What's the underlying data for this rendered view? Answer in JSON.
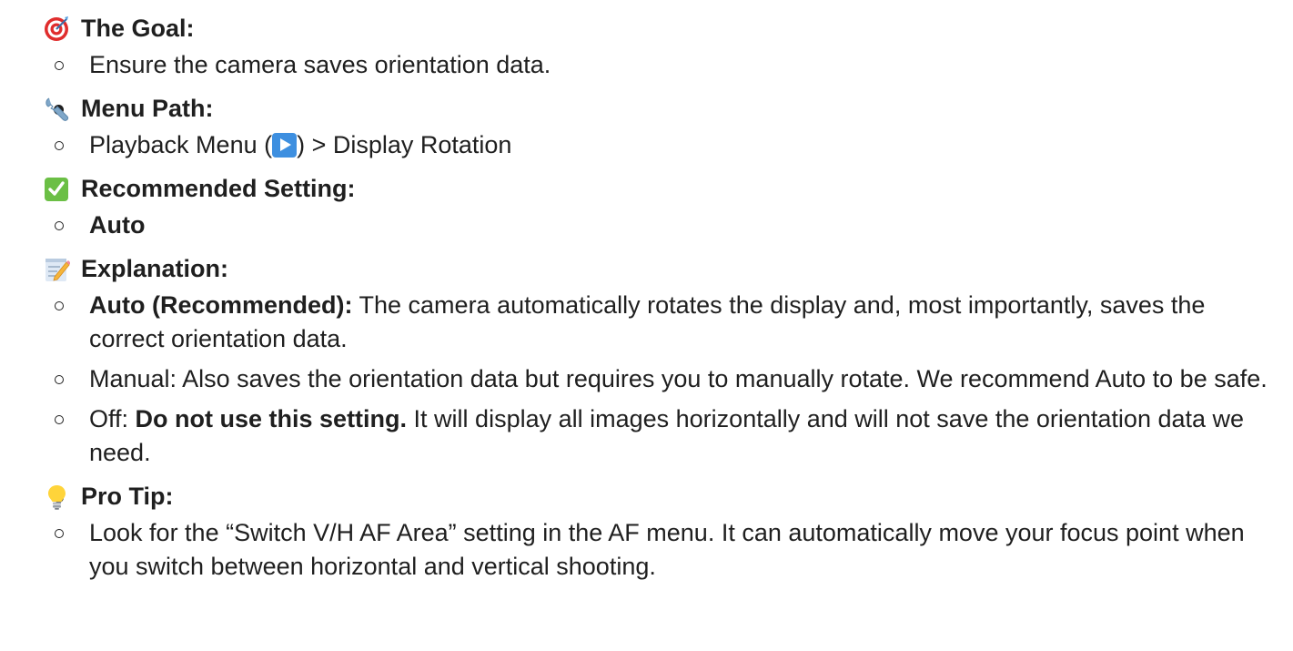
{
  "sections": [
    {
      "icon": "direct-hit-target-icon",
      "heading": "The Goal:",
      "items": [
        {
          "text": "Ensure the camera saves orientation data."
        }
      ]
    },
    {
      "icon": "wrench-icon",
      "heading": "Menu Path:",
      "items": [
        {
          "before": "Playback Menu (",
          "icon": "play-button-icon",
          "after": ") > Display Rotation"
        }
      ]
    },
    {
      "icon": "check-mark-button-icon",
      "heading": "Recommended Setting:",
      "items": [
        {
          "bold": "Auto"
        }
      ]
    },
    {
      "icon": "memo-pencil-icon",
      "heading": "Explanation:",
      "items": [
        {
          "bold": "Auto (Recommended):",
          "text": " The camera automatically rotates the display and, most importantly, saves the correct orientation data."
        },
        {
          "text": "Manual: Also saves the orientation data but requires you to manually rotate. We recommend Auto to be safe."
        },
        {
          "before": "Off: ",
          "bold": "Do not use this setting.",
          "text": " It will display all images horizontally and will not save the orientation data we need."
        }
      ]
    },
    {
      "icon": "light-bulb-icon",
      "heading": "Pro Tip:",
      "items": [
        {
          "text": "Look for the “Switch V/H AF Area” setting in the AF menu. It can automatically move your focus point when you switch between horizontal and vertical shooting."
        }
      ]
    }
  ],
  "colors": {
    "text": "#1f1f1f",
    "target_red": "#e02d2d",
    "wrench_blue": "#7fa7c9",
    "check_green": "#6bbf45",
    "play_blue": "#3d8fe0",
    "bulb_yellow": "#ffd43a"
  }
}
